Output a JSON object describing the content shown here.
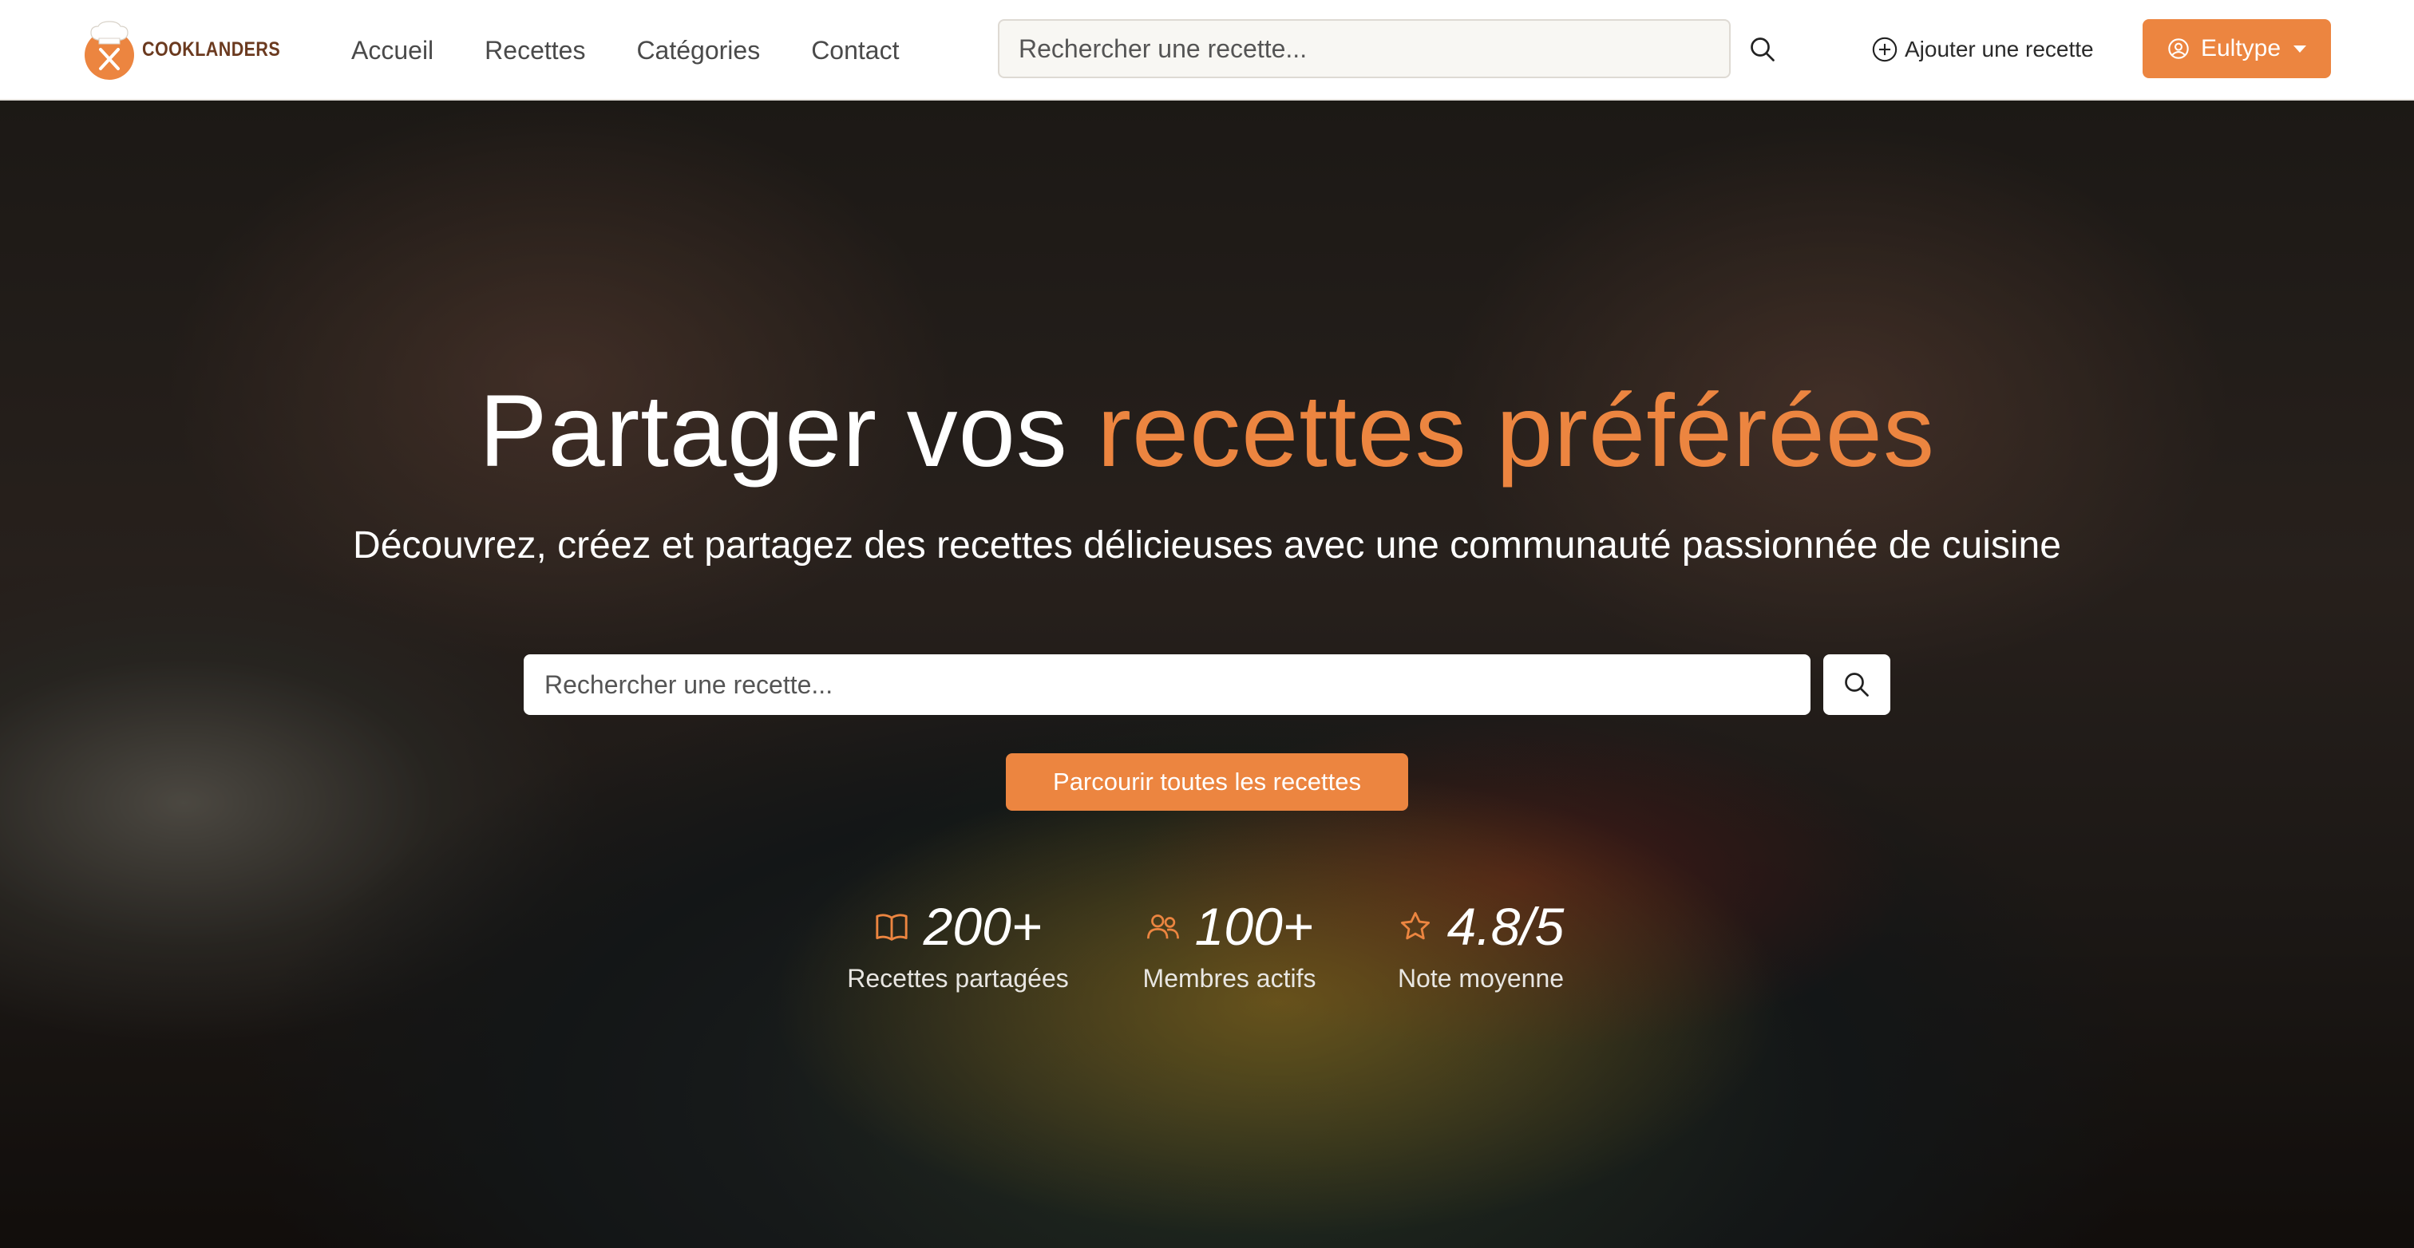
{
  "brand": {
    "name": "COOKLANDERS",
    "accent_color": "#ec8540",
    "brand_dark": "#6b3a1f"
  },
  "nav": {
    "links": [
      "Accueil",
      "Recettes",
      "Catégories",
      "Contact"
    ],
    "search_placeholder": "Rechercher une recette...",
    "search_icon": "search-icon",
    "add_recipe_label": "Ajouter une recette",
    "add_recipe_icon": "plus-circle-icon",
    "user_label": "Eultype",
    "user_icon": "user-circle-icon"
  },
  "hero": {
    "title_part1": "Partager vos",
    "title_accent": "recettes préférées",
    "subtitle": "Découvrez, créez et partagez des recettes délicieuses avec une communauté passionnée de cuisine",
    "search_placeholder": "Rechercher une recette...",
    "browse_label": "Parcourir toutes les recettes",
    "stats": [
      {
        "icon": "book-icon",
        "value": "200+",
        "label": "Recettes partagées"
      },
      {
        "icon": "users-icon",
        "value": "100+",
        "label": "Membres actifs"
      },
      {
        "icon": "star-icon",
        "value": "4.8/5",
        "label": "Note moyenne"
      }
    ]
  }
}
